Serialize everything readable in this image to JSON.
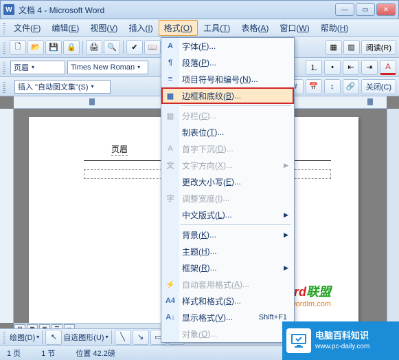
{
  "window": {
    "title": "文档 4 - Microsoft Word",
    "app_icon_letter": "W"
  },
  "menubar": [
    {
      "label": "文件",
      "key": "F"
    },
    {
      "label": "编辑",
      "key": "E"
    },
    {
      "label": "视图",
      "key": "V"
    },
    {
      "label": "插入",
      "key": "I"
    },
    {
      "label": "格式",
      "key": "O",
      "active": true
    },
    {
      "label": "工具",
      "key": "T"
    },
    {
      "label": "表格",
      "key": "A"
    },
    {
      "label": "窗口",
      "key": "W"
    },
    {
      "label": "帮助",
      "key": "H"
    }
  ],
  "format_bar": {
    "style_label": "页眉",
    "font_label": "Times New Roman"
  },
  "autotext_bar": {
    "label": "插入 \"自动图文集\"(S)"
  },
  "extra_btns": {
    "read": "阅读(R)",
    "close": "关闭(C)"
  },
  "dropdown": [
    {
      "label": "字体",
      "key": "F",
      "icon": "A",
      "enabled": true
    },
    {
      "label": "段落",
      "key": "P",
      "icon": "¶",
      "enabled": true
    },
    {
      "label": "项目符号和编号",
      "key": "N",
      "icon": "≡",
      "enabled": true
    },
    {
      "label": "边框和底纹",
      "key": "B",
      "icon": "▦",
      "enabled": true,
      "highlighted": true
    },
    {
      "sep": true
    },
    {
      "label": "分栏",
      "key": "C",
      "icon": "▥",
      "enabled": false
    },
    {
      "label": "制表位",
      "key": "T",
      "icon": "",
      "enabled": true
    },
    {
      "label": "首字下沉",
      "key": "D",
      "icon": "A",
      "enabled": false
    },
    {
      "label": "文字方向",
      "key": "X",
      "icon": "文",
      "enabled": false,
      "submenu": true
    },
    {
      "label": "更改大小写",
      "key": "E",
      "icon": "",
      "enabled": true
    },
    {
      "label": "调整宽度",
      "key": "I",
      "icon": "字",
      "enabled": false
    },
    {
      "label": "中文版式",
      "key": "L",
      "icon": "",
      "enabled": true,
      "submenu": true
    },
    {
      "sep": true
    },
    {
      "label": "背景",
      "key": "K",
      "icon": "",
      "enabled": true,
      "submenu": true
    },
    {
      "label": "主题",
      "key": "H",
      "icon": "",
      "enabled": true
    },
    {
      "label": "框架",
      "key": "R",
      "icon": "",
      "enabled": true,
      "submenu": true
    },
    {
      "label": "自动套用格式",
      "key": "A",
      "icon": "⚡",
      "enabled": false
    },
    {
      "label": "样式和格式",
      "key": "S",
      "icon": "A4",
      "enabled": true
    },
    {
      "label": "显示格式",
      "key": "V",
      "icon": "A↓",
      "enabled": true,
      "accel": "Shift+F1"
    },
    {
      "label": "对象",
      "key": "O",
      "icon": "",
      "enabled": false
    }
  ],
  "doc": {
    "header_label": "页眉"
  },
  "watermark": {
    "line1a": "Word",
    "line1b": "联盟",
    "line2": "www.wordlm.com"
  },
  "drawbar": {
    "draw": "绘图(D)",
    "autoshape": "自选图形(U)"
  },
  "status": {
    "page": "1 页",
    "section": "1 节",
    "pos": "位置 42.2磅"
  },
  "badge": {
    "line1": "电脑百科知识",
    "line2": "www.pc-daily.com"
  }
}
